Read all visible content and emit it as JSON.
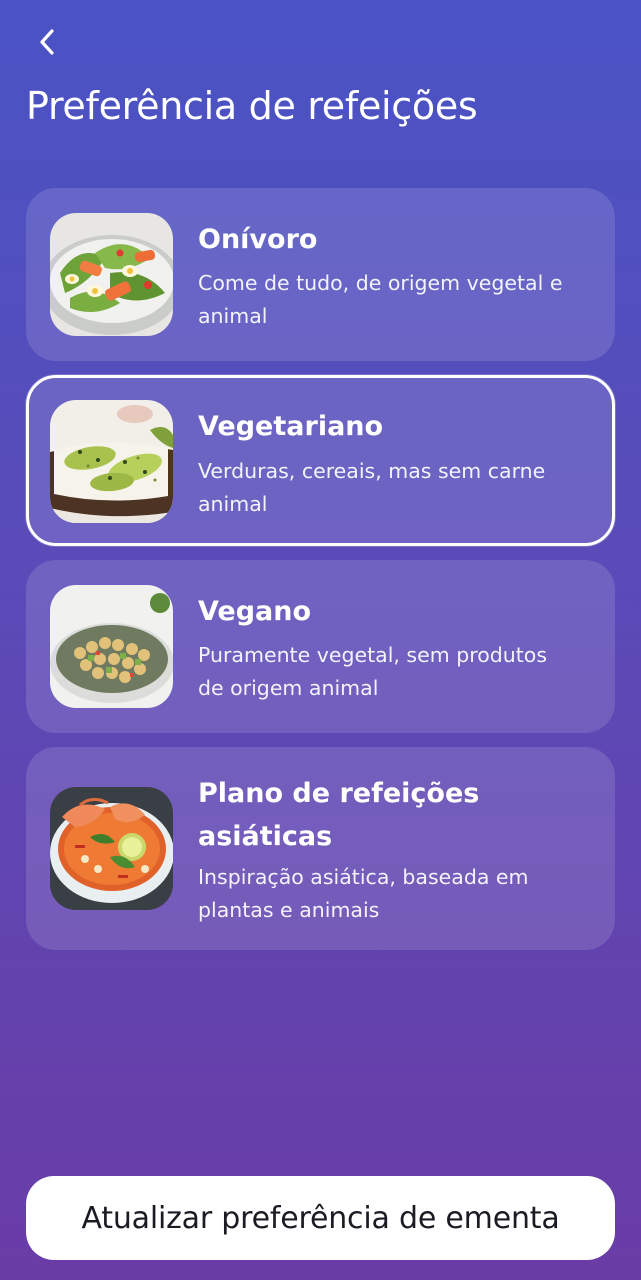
{
  "header": {
    "back_icon": "chevron-left-icon",
    "title": "Preferência de refeições"
  },
  "options": [
    {
      "title": "Onívoro",
      "description": "Come de tudo, de origem vegetal e animal",
      "image": "salad-with-salmon-and-eggs",
      "selected": false
    },
    {
      "title": "Vegetariano",
      "description": "Verduras, cereais, mas sem carne animal",
      "image": "avocado-toast",
      "selected": true
    },
    {
      "title": "Vegano",
      "description": "Puramente vegetal, sem produtos de origem animal",
      "image": "chickpea-salad-bowl",
      "selected": false
    },
    {
      "title": "Plano de refeições asiáticas",
      "description": "Inspiração asiática, baseada em plantas e animais",
      "image": "tom-yum-shrimp-soup",
      "selected": false
    }
  ],
  "footer": {
    "update_label": "Atualizar preferência de ementa"
  },
  "colors": {
    "background_top": "#4a53c4",
    "background_bottom": "#6a3ca6",
    "button_bg": "#ffffff",
    "button_text": "#1b1b24"
  }
}
